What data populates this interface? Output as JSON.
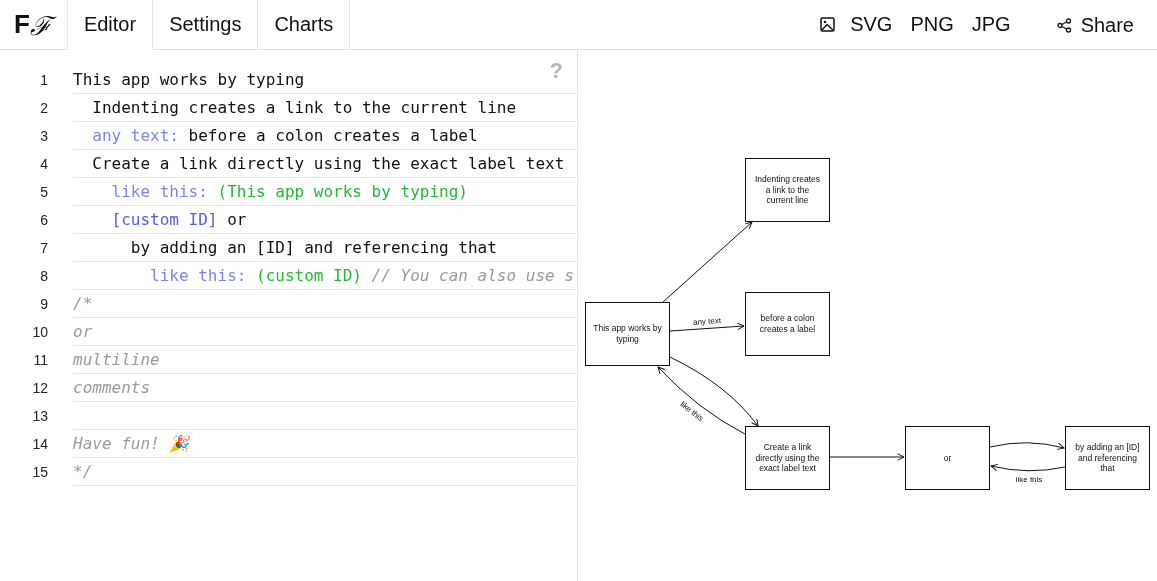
{
  "header": {
    "logo": "**F**ℱ",
    "tabs": [
      {
        "label": "Editor",
        "selected": true
      },
      {
        "label": "Settings",
        "selected": false
      },
      {
        "label": "Charts",
        "selected": false
      }
    ],
    "exports": [
      "SVG",
      "PNG",
      "JPG"
    ],
    "share": "Share"
  },
  "editor": {
    "help": "?",
    "lines": [
      {
        "number": "1",
        "segments": [
          {
            "kind": "text",
            "text": "This app works by typing"
          }
        ]
      },
      {
        "number": "2",
        "segments": [
          {
            "kind": "text",
            "text": "  Indenting creates a link to the current line"
          }
        ]
      },
      {
        "number": "3",
        "segments": [
          {
            "kind": "label",
            "text": "  any text:"
          },
          {
            "kind": "text",
            "text": " before a colon creates a label"
          }
        ]
      },
      {
        "number": "4",
        "segments": [
          {
            "kind": "text",
            "text": "  Create a link directly using the exact label text"
          }
        ]
      },
      {
        "number": "5",
        "segments": [
          {
            "kind": "label",
            "text": "    like this:"
          },
          {
            "kind": "link",
            "text": " (This app works by typing)"
          }
        ]
      },
      {
        "number": "6",
        "segments": [
          {
            "kind": "id",
            "text": "    [custom ID]"
          },
          {
            "kind": "text",
            "text": " or"
          }
        ]
      },
      {
        "number": "7",
        "segments": [
          {
            "kind": "text",
            "text": "      by adding an [ID] and referencing that"
          }
        ]
      },
      {
        "number": "8",
        "segments": [
          {
            "kind": "label",
            "text": "        like this:"
          },
          {
            "kind": "link",
            "text": " (custom ID)"
          },
          {
            "kind": "comment",
            "text": " // You can also use s"
          }
        ]
      },
      {
        "number": "9",
        "segments": [
          {
            "kind": "comment",
            "text": "/*"
          }
        ]
      },
      {
        "number": "10",
        "segments": [
          {
            "kind": "comment",
            "text": "or"
          }
        ]
      },
      {
        "number": "11",
        "segments": [
          {
            "kind": "comment",
            "text": "multiline"
          }
        ]
      },
      {
        "number": "12",
        "segments": [
          {
            "kind": "comment",
            "text": "comments"
          }
        ]
      },
      {
        "number": "13"
      },
      {
        "number": "14",
        "segments": [
          {
            "kind": "comment",
            "text": "Have fun! 🎉"
          }
        ]
      },
      {
        "number": "15",
        "segments": [
          {
            "kind": "comment",
            "text": "*/"
          }
        ]
      }
    ]
  },
  "diagram": {
    "nodes": [
      {
        "text": "This app works by typing"
      },
      {
        "text": "Indenting creates a link to the current line"
      },
      {
        "text": "before a colon creates a label"
      },
      {
        "text": "Create a link directly using the exact label text"
      },
      {
        "text": "or"
      },
      {
        "text": "by adding an [ID] and referencing that"
      }
    ],
    "edge_labels": [
      "any text",
      "like this",
      "like this"
    ]
  }
}
